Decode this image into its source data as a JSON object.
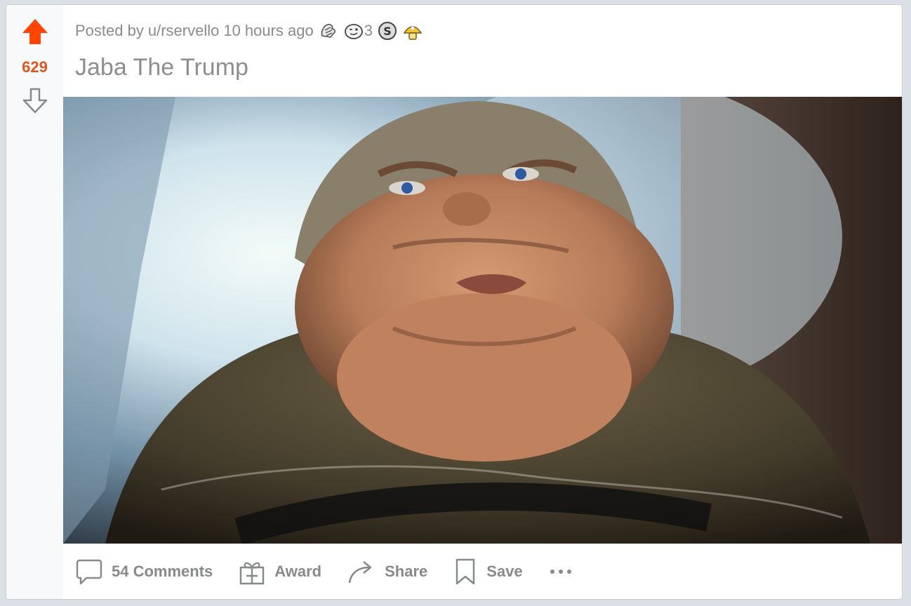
{
  "post": {
    "score": "629",
    "posted_by_prefix": "Posted by",
    "author": "u/rservello",
    "time_ago": "10 hours ago",
    "awards": [
      {
        "icon": "hands-award-icon",
        "count": ""
      },
      {
        "icon": "wink-award-icon",
        "count": "3"
      },
      {
        "icon": "silver-s-award-icon",
        "count": ""
      },
      {
        "icon": "gold-mushroom-award-icon",
        "count": ""
      }
    ],
    "title": "Jaba The Trump"
  },
  "actions": {
    "comments_label": "54 Comments",
    "award_label": "Award",
    "share_label": "Share",
    "save_label": "Save"
  },
  "colors": {
    "upvote": "#ff4500",
    "score": "#e1531f",
    "meta_text": "#8b8b8b",
    "action_text": "#878a8c"
  }
}
